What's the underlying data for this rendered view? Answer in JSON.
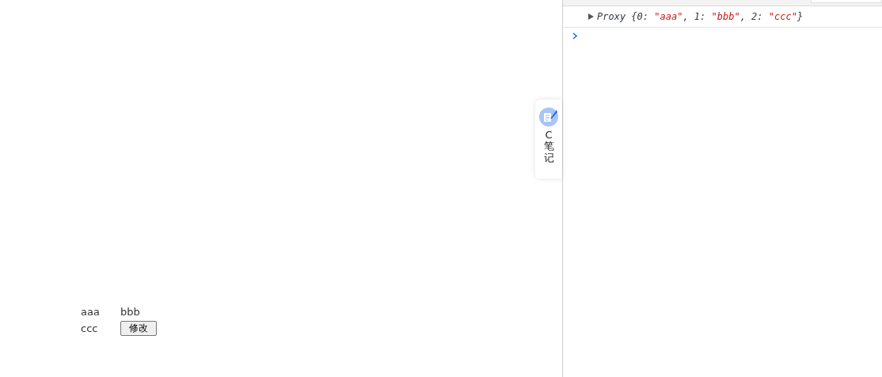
{
  "page": {
    "items": [
      {
        "text": "aaa"
      },
      {
        "text": "bbb"
      },
      {
        "text": "ccc"
      }
    ],
    "button": "修改"
  },
  "side_widget": {
    "label": "C笔记"
  },
  "console": {
    "entries": [
      {
        "label": "Proxy",
        "expanded": false,
        "open": "{",
        "close": "}",
        "fields": [
          {
            "key": "0:",
            "value": "\"aaa\"",
            "separator": ","
          },
          {
            "key": "1:",
            "value": "\"bbb\"",
            "separator": ","
          },
          {
            "key": "2:",
            "value": "\"ccc\""
          }
        ]
      }
    ]
  }
}
